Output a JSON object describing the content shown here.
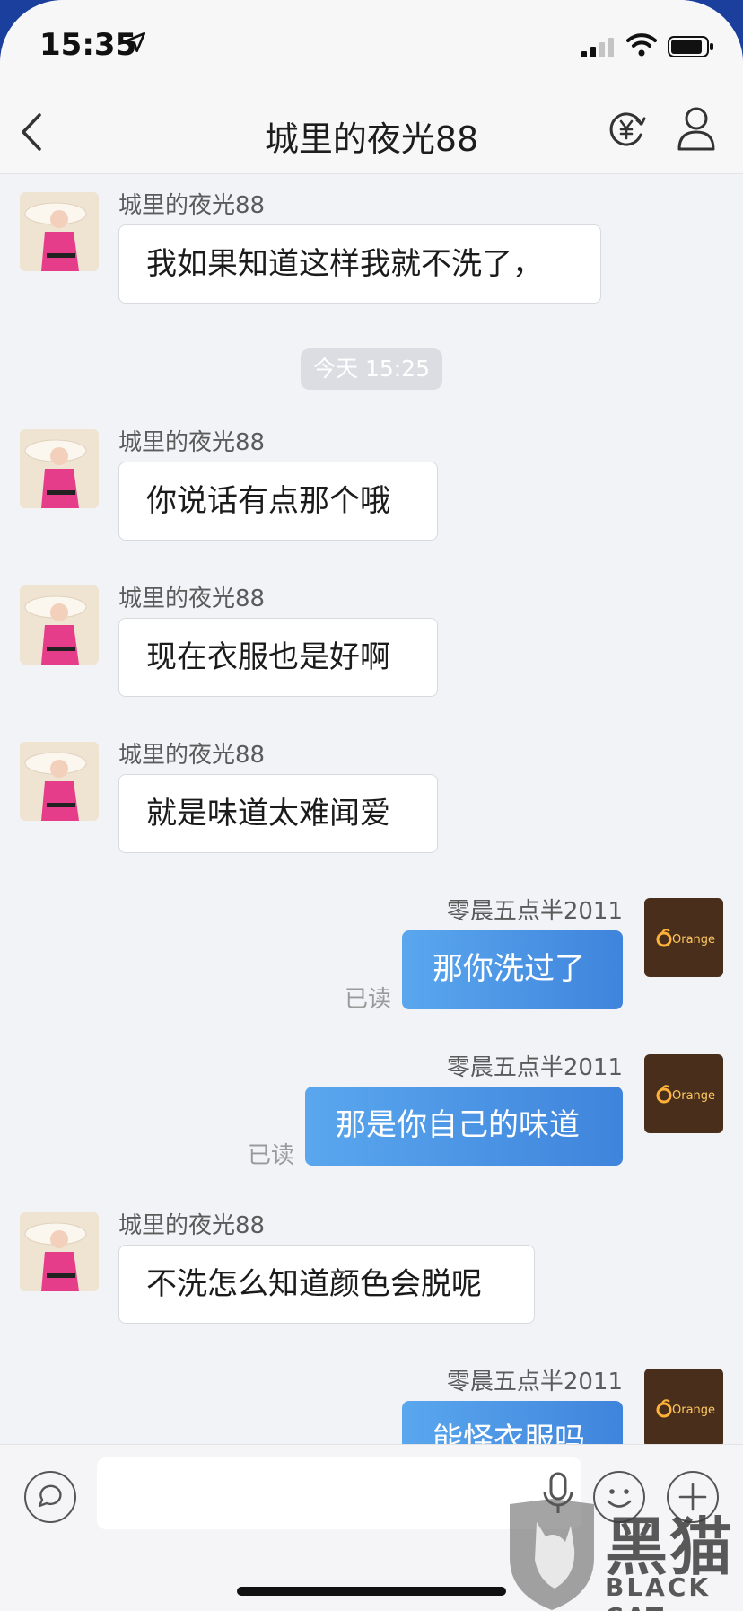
{
  "status_bar": {
    "time": "15:35"
  },
  "nav": {
    "title": "城里的夜光88"
  },
  "contact_name": "城里的夜光88",
  "self_name": "零晨五点半2011",
  "messages": [
    {
      "dir": "in",
      "text": "我如果知道这样我就不洗了，"
    },
    {
      "dir": "time",
      "text": "今天 15:25"
    },
    {
      "dir": "in",
      "text": "你说话有点那个哦"
    },
    {
      "dir": "in",
      "text": "现在衣服也是好啊"
    },
    {
      "dir": "in",
      "text": "就是味道太难闻爱"
    },
    {
      "dir": "out",
      "text": "那你洗过了",
      "status": "已读"
    },
    {
      "dir": "out",
      "text": "那是你自己的味道",
      "status": "已读"
    },
    {
      "dir": "in",
      "text": "不洗怎么知道颜色会脱呢"
    },
    {
      "dir": "out",
      "text": "能怪衣服吗"
    }
  ],
  "self_avatar_text": "Orange",
  "input": {
    "value": ""
  },
  "watermark": {
    "cn": "黑猫",
    "en": "BLACK CAT"
  },
  "colors": {
    "out_bubble": "#4a90e2",
    "in_bubble": "#ffffff",
    "background": "#f2f3f7"
  }
}
